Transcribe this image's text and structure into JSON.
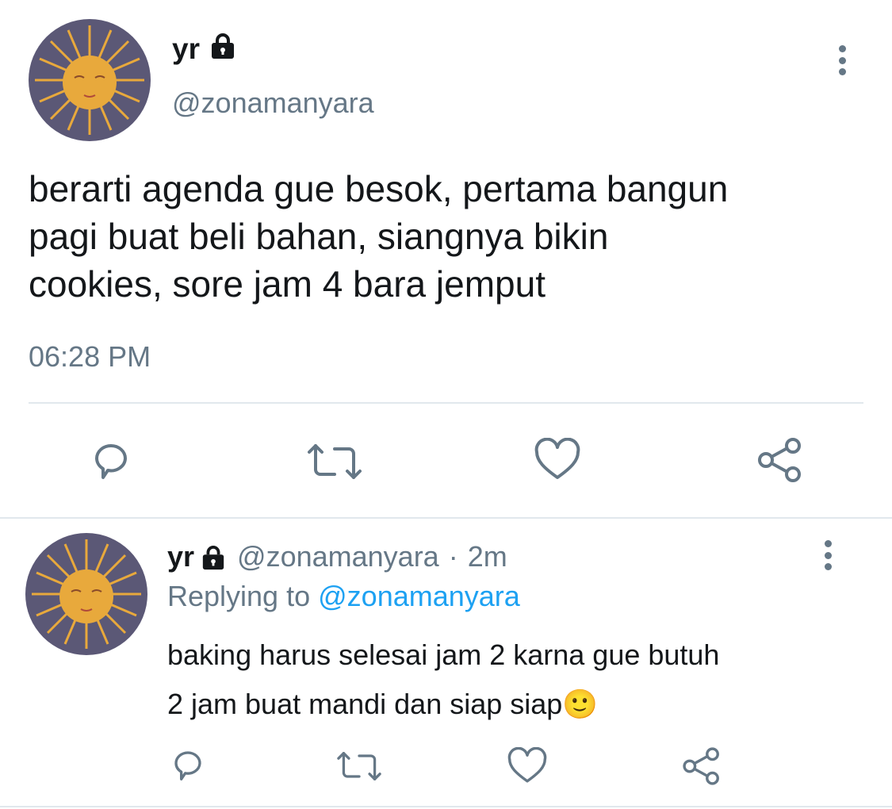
{
  "main_tweet": {
    "display_name": "yr",
    "handle": "@zonamanyara",
    "text_lines": [
      "berarti agenda gue besok, pertama bangun",
      "pagi buat beli bahan, siangnya bikin",
      "cookies, sore jam 4 bara jemput"
    ],
    "time": "06:28 PM",
    "icons": {
      "lock": "lock-icon",
      "more": "more-vertical-icon",
      "reply": "reply-icon",
      "retweet": "retweet-icon",
      "like": "heart-icon",
      "share": "share-icon"
    }
  },
  "reply_tweet": {
    "display_name": "yr",
    "handle": "@zonamanyara",
    "separator": "·",
    "age": "2m",
    "replying_label": "Replying to",
    "replying_handle": "@zonamanyara",
    "text_lines": [
      "baking harus selesai jam 2 karna gue butuh",
      "2 jam buat mandi dan siap siap"
    ],
    "emoji": "🙂"
  },
  "colors": {
    "text": "#14171a",
    "secondary": "#657786",
    "link": "#1da1f2",
    "divider": "#e1e8ed",
    "avatar_bg": "#5b5876",
    "sun": "#e8a93c"
  }
}
